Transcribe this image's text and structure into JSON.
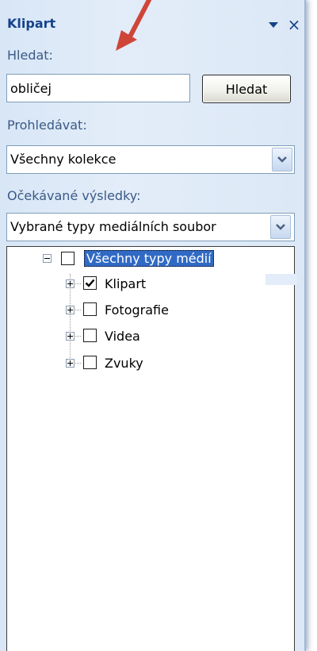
{
  "pane": {
    "title": "Klipart",
    "close_glyph": "×"
  },
  "search": {
    "label": "Hledat:",
    "value": "obličej",
    "button_label": "Hledat"
  },
  "scope": {
    "label": "Prohledávat:",
    "selected": "Všechny kolekce"
  },
  "results": {
    "label": "Očekávané výsledky:",
    "selected": "Vybrané typy mediálních soubor"
  },
  "tree": {
    "root": {
      "label": "Všechny typy médií",
      "checked": false,
      "expanded": true
    },
    "items": [
      {
        "label": "Klipart",
        "checked": true
      },
      {
        "label": "Fotografie",
        "checked": false
      },
      {
        "label": "Videa",
        "checked": false
      },
      {
        "label": "Zvuky",
        "checked": false
      }
    ]
  },
  "colors": {
    "title": "#15428b",
    "label": "#3b5a85",
    "selection": "#316ac5",
    "annotation_arrow": "#d0453a"
  },
  "icons": {
    "dropdown": "triangle-down-icon",
    "close": "close-icon",
    "select_chevron": "chevron-down-icon",
    "tree_collapse": "minus-box-icon",
    "tree_expand": "plus-box-icon",
    "check": "checkmark-icon",
    "annotation": "red-arrow-icon"
  }
}
